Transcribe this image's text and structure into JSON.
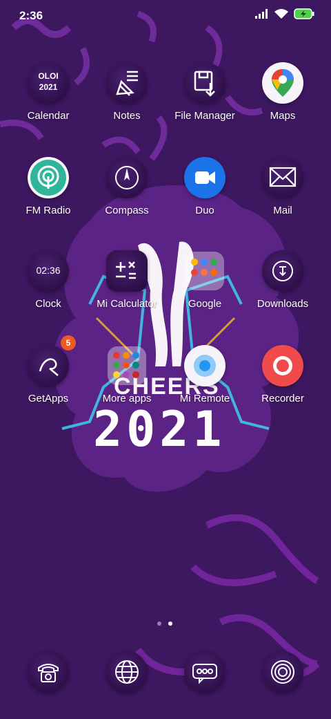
{
  "status_bar": {
    "time": "2:36",
    "signal_icon": "signal-icon",
    "wifi_icon": "wifi-icon",
    "battery_icon": "battery-charging-icon"
  },
  "apps": [
    {
      "label": "Calendar",
      "icon": "calendar-icon"
    },
    {
      "label": "Notes",
      "icon": "notes-icon"
    },
    {
      "label": "File Manager",
      "icon": "file-manager-icon"
    },
    {
      "label": "Maps",
      "icon": "maps-icon"
    },
    {
      "label": "FM Radio",
      "icon": "fm-radio-icon"
    },
    {
      "label": "Compass",
      "icon": "compass-icon"
    },
    {
      "label": "Duo",
      "icon": "duo-icon"
    },
    {
      "label": "Mail",
      "icon": "mail-icon"
    },
    {
      "label": "Clock",
      "icon": "clock-icon"
    },
    {
      "label": "Mi Calculator",
      "icon": "calculator-icon"
    },
    {
      "label": "Google",
      "icon": "folder-icon"
    },
    {
      "label": "Downloads",
      "icon": "downloads-icon"
    },
    {
      "label": "GetApps",
      "icon": "getapps-icon"
    },
    {
      "label": "More apps",
      "icon": "folder-icon"
    },
    {
      "label": "Mi Remote",
      "icon": "mi-remote-icon"
    },
    {
      "label": "Recorder",
      "icon": "recorder-icon"
    }
  ],
  "calendar_icon_text": {
    "line1": "OLOI",
    "line2": "2021"
  },
  "clock_icon_text": "02:36",
  "getapps_badge": "5",
  "wallpaper_text": {
    "line1": "CHEERS",
    "line2": "2021"
  },
  "page_indicator": {
    "pages": 2,
    "current": 2
  },
  "dock": [
    {
      "icon": "phone-icon"
    },
    {
      "icon": "browser-icon"
    },
    {
      "icon": "messages-icon"
    },
    {
      "icon": "camera-icon"
    }
  ]
}
